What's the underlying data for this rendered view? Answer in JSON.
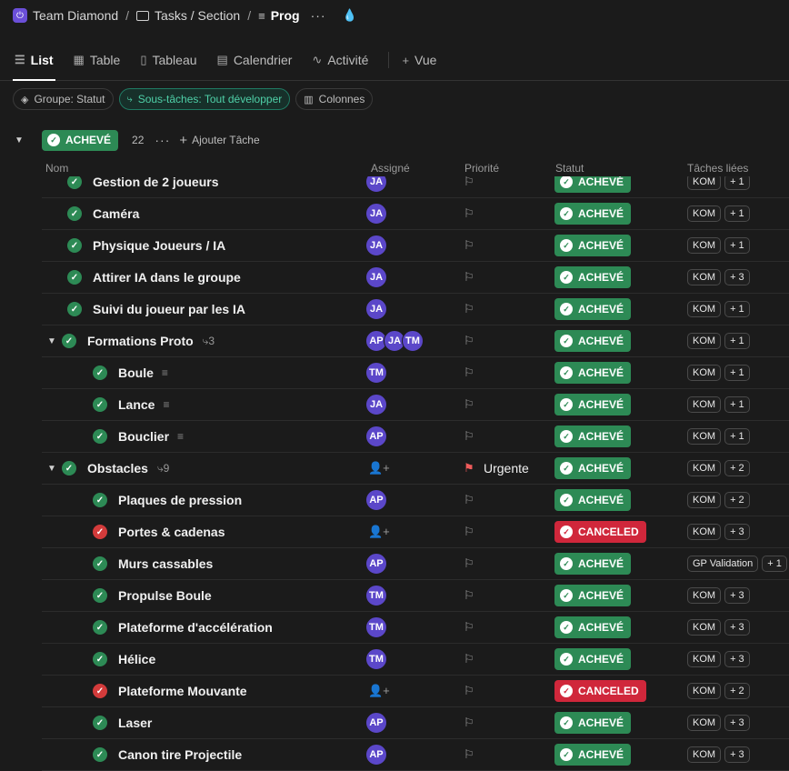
{
  "breadcrumb": {
    "workspace": "Team Diamond",
    "folder": "Tasks / Section",
    "list": "Prog"
  },
  "views": [
    {
      "label": "List",
      "icon": "list-icon"
    },
    {
      "label": "Table",
      "icon": "table-icon"
    },
    {
      "label": "Tableau",
      "icon": "board-icon"
    },
    {
      "label": "Calendrier",
      "icon": "calendar-icon"
    },
    {
      "label": "Activité",
      "icon": "activity-icon"
    },
    {
      "label": "Vue",
      "icon": "plus-icon"
    }
  ],
  "filters": [
    {
      "label": "Groupe: Statut",
      "icon": "layers-icon"
    },
    {
      "label": "Sous-tâches: Tout développer",
      "icon": "subtasks-icon"
    },
    {
      "label": "Colonnes",
      "icon": "columns-icon"
    }
  ],
  "group": {
    "status": "ACHEVÉ",
    "count": "22",
    "add_task": "Ajouter Tâche"
  },
  "columns": {
    "name": "Nom",
    "assignee": "Assigné",
    "priority": "Priorité",
    "status": "Statut",
    "linked": "Tâches liées"
  },
  "colors": {
    "done": "#2d8a55",
    "canceled": "#d0273b",
    "avatar": "#5b47c9",
    "urgent": "#ef5b5b"
  },
  "rows": [
    {
      "name": "Gestion de 2 joueurs",
      "level": 0,
      "state": "done",
      "assignees": [
        "JA"
      ],
      "priority": "",
      "status": "ACHEVÉ",
      "links": [
        "KOM",
        "+ 1"
      ]
    },
    {
      "name": "Caméra",
      "level": 0,
      "state": "done",
      "assignees": [
        "JA"
      ],
      "priority": "",
      "status": "ACHEVÉ",
      "links": [
        "KOM",
        "+ 1"
      ]
    },
    {
      "name": "Physique Joueurs / IA",
      "level": 0,
      "state": "done",
      "assignees": [
        "JA"
      ],
      "priority": "",
      "status": "ACHEVÉ",
      "links": [
        "KOM",
        "+ 1"
      ]
    },
    {
      "name": "Attirer IA dans le groupe",
      "level": 0,
      "state": "done",
      "assignees": [
        "JA"
      ],
      "priority": "",
      "status": "ACHEVÉ",
      "links": [
        "KOM",
        "+ 3"
      ]
    },
    {
      "name": "Suivi du joueur par les IA",
      "level": 0,
      "state": "done",
      "assignees": [
        "JA"
      ],
      "priority": "",
      "status": "ACHEVÉ",
      "links": [
        "KOM",
        "+ 1"
      ]
    },
    {
      "name": "Formations Proto",
      "level": 0,
      "parent": true,
      "subcount": "3",
      "state": "done",
      "assignees": [
        "AP",
        "JA",
        "TM"
      ],
      "priority": "",
      "status": "ACHEVÉ",
      "links": [
        "KOM",
        "+ 1"
      ]
    },
    {
      "name": "Boule",
      "level": 1,
      "desc": true,
      "state": "done",
      "assignees": [
        "TM"
      ],
      "priority": "",
      "status": "ACHEVÉ",
      "links": [
        "KOM",
        "+ 1"
      ]
    },
    {
      "name": "Lance",
      "level": 1,
      "desc": true,
      "state": "done",
      "assignees": [
        "JA"
      ],
      "priority": "",
      "status": "ACHEVÉ",
      "links": [
        "KOM",
        "+ 1"
      ]
    },
    {
      "name": "Bouclier",
      "level": 1,
      "desc": true,
      "state": "done",
      "assignees": [
        "AP"
      ],
      "priority": "",
      "status": "ACHEVÉ",
      "links": [
        "KOM",
        "+ 1"
      ]
    },
    {
      "name": "Obstacles",
      "level": 0,
      "parent": true,
      "subcount": "9",
      "state": "done",
      "assignees": [],
      "priority": "Urgente",
      "status": "ACHEVÉ",
      "links": [
        "KOM",
        "+ 2"
      ]
    },
    {
      "name": "Plaques de pression",
      "level": 1,
      "state": "done",
      "assignees": [
        "AP"
      ],
      "priority": "",
      "status": "ACHEVÉ",
      "links": [
        "KOM",
        "+ 2"
      ]
    },
    {
      "name": "Portes & cadenas",
      "level": 1,
      "state": "canceled",
      "assignees": [],
      "priority": "",
      "status": "CANCELED",
      "links": [
        "KOM",
        "+ 3"
      ]
    },
    {
      "name": "Murs cassables",
      "level": 1,
      "state": "done",
      "assignees": [
        "AP"
      ],
      "priority": "",
      "status": "ACHEVÉ",
      "links": [
        "GP Validation",
        "+ 1"
      ]
    },
    {
      "name": "Propulse Boule",
      "level": 1,
      "state": "done",
      "assignees": [
        "TM"
      ],
      "priority": "",
      "status": "ACHEVÉ",
      "links": [
        "KOM",
        "+ 3"
      ]
    },
    {
      "name": "Plateforme d'accélération",
      "level": 1,
      "state": "done",
      "assignees": [
        "TM"
      ],
      "priority": "",
      "status": "ACHEVÉ",
      "links": [
        "KOM",
        "+ 3"
      ]
    },
    {
      "name": "Hélice",
      "level": 1,
      "state": "done",
      "assignees": [
        "TM"
      ],
      "priority": "",
      "status": "ACHEVÉ",
      "links": [
        "KOM",
        "+ 3"
      ]
    },
    {
      "name": "Plateforme Mouvante",
      "level": 1,
      "state": "canceled",
      "assignees": [],
      "priority": "",
      "status": "CANCELED",
      "links": [
        "KOM",
        "+ 2"
      ]
    },
    {
      "name": "Laser",
      "level": 1,
      "state": "done",
      "assignees": [
        "AP"
      ],
      "priority": "",
      "status": "ACHEVÉ",
      "links": [
        "KOM",
        "+ 3"
      ]
    },
    {
      "name": "Canon tire Projectile",
      "level": 1,
      "state": "done",
      "assignees": [
        "AP"
      ],
      "priority": "",
      "status": "ACHEVÉ",
      "links": [
        "KOM",
        "+ 3"
      ]
    }
  ]
}
